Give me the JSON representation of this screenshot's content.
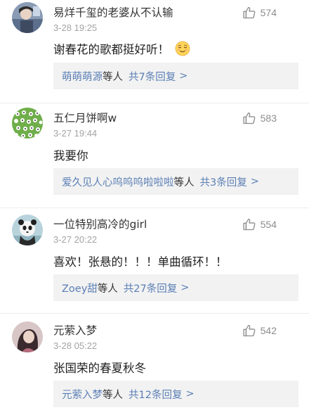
{
  "comments": [
    {
      "username": "易烊千玺的老婆从不认输",
      "time": "3-28 19:25",
      "likes": "574",
      "content": "谢春花的歌都挺好听！",
      "emoji": "relieved-face",
      "reply_users": "萌萌萌源",
      "reply_suffix": "等人",
      "reply_total": "共7条回复",
      "reply_arrow": ">"
    },
    {
      "username": "五仁月饼啊w",
      "time": "3-27 19:44",
      "likes": "583",
      "content": "我要你",
      "reply_users": "爱久见人心呜呜呜啦啦啦",
      "reply_suffix": "等人",
      "reply_total": "共3条回复",
      "reply_arrow": ">"
    },
    {
      "username": "一位特别高冷的girl",
      "time": "3-27 20:22",
      "likes": "554",
      "content": "喜欢！张悬的！！！单曲循环！！",
      "reply_users": "Zoey甜",
      "reply_suffix": "等人",
      "reply_total": "共27条回复",
      "reply_arrow": ">"
    },
    {
      "username": "元萦入梦",
      "time": "3-28 05:22",
      "likes": "542",
      "content": "张国荣的春夏秋冬",
      "reply_users": "元萦入梦",
      "reply_suffix": "等人",
      "reply_total": "共12条回复",
      "reply_arrow": ">"
    }
  ],
  "colors": {
    "link": "#5b7fb5",
    "secondary_text": "#a3a3a3",
    "reply_background": "#f2f2f2",
    "like_icon": "#8c8c8c"
  },
  "icons": {
    "like": "thumbs-up-icon",
    "avatar": "avatar"
  }
}
